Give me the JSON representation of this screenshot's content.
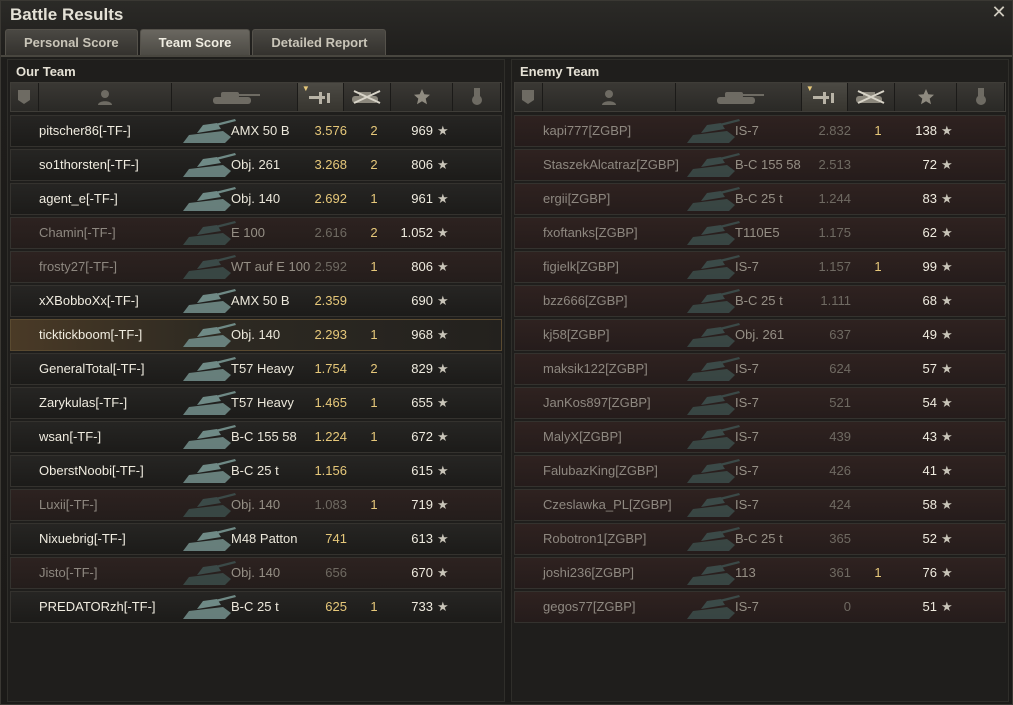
{
  "window": {
    "title": "Battle Results",
    "close_icon": "close-icon"
  },
  "tabs": [
    {
      "label": "Personal Score",
      "active": false
    },
    {
      "label": "Team Score",
      "active": true
    },
    {
      "label": "Detailed Report",
      "active": false
    }
  ],
  "columns": [
    "squad-icon",
    "player-icon",
    "tank-icon",
    "xp-icon",
    "kills-icon",
    "score-star-icon",
    "medal-icon"
  ],
  "our_team": {
    "title": "Our Team",
    "rows": [
      {
        "name": "pitscher86[-TF-]",
        "vehicle": "AMX 50 B",
        "xp": "3.576",
        "kills": "2",
        "score": "969",
        "state": "alive"
      },
      {
        "name": "so1thorsten[-TF-]",
        "vehicle": "Obj. 261",
        "xp": "3.268",
        "kills": "2",
        "score": "806",
        "state": "alive"
      },
      {
        "name": "agent_e[-TF-]",
        "vehicle": "Obj. 140",
        "xp": "2.692",
        "kills": "1",
        "score": "961",
        "state": "alive"
      },
      {
        "name": "Chamin[-TF-]",
        "vehicle": "E 100",
        "xp": "2.616",
        "kills": "2",
        "score": "1.052",
        "state": "dead"
      },
      {
        "name": "frosty27[-TF-]",
        "vehicle": "WT auf E 100",
        "xp": "2.592",
        "kills": "1",
        "score": "806",
        "state": "dead"
      },
      {
        "name": "xXBobboXx[-TF-]",
        "vehicle": "AMX 50 B",
        "xp": "2.359",
        "kills": "",
        "score": "690",
        "state": "alive"
      },
      {
        "name": "ticktickboom[-TF-]",
        "vehicle": "Obj. 140",
        "xp": "2.293",
        "kills": "1",
        "score": "968",
        "state": "self"
      },
      {
        "name": "GeneralTotal[-TF-]",
        "vehicle": "T57 Heavy",
        "xp": "1.754",
        "kills": "2",
        "score": "829",
        "state": "alive"
      },
      {
        "name": "Zarykulas[-TF-]",
        "vehicle": "T57 Heavy",
        "xp": "1.465",
        "kills": "1",
        "score": "655",
        "state": "alive"
      },
      {
        "name": "wsan[-TF-]",
        "vehicle": "B-C 155 58",
        "xp": "1.224",
        "kills": "1",
        "score": "672",
        "state": "alive"
      },
      {
        "name": "OberstNoobi[-TF-]",
        "vehicle": "B-C 25 t",
        "xp": "1.156",
        "kills": "",
        "score": "615",
        "state": "alive"
      },
      {
        "name": "Luxii[-TF-]",
        "vehicle": "Obj. 140",
        "xp": "1.083",
        "kills": "1",
        "score": "719",
        "state": "dead"
      },
      {
        "name": "Nixuebrig[-TF-]",
        "vehicle": "M48 Patton",
        "xp": "741",
        "kills": "",
        "score": "613",
        "state": "alive"
      },
      {
        "name": "Jisto[-TF-]",
        "vehicle": "Obj. 140",
        "xp": "656",
        "kills": "",
        "score": "670",
        "state": "dead"
      },
      {
        "name": "PREDATORzh[-TF-]",
        "vehicle": "B-C 25 t",
        "xp": "625",
        "kills": "1",
        "score": "733",
        "state": "alive"
      }
    ]
  },
  "enemy_team": {
    "title": "Enemy Team",
    "rows": [
      {
        "name": "kapi777[ZGBP]",
        "vehicle": "IS-7",
        "xp": "2.832",
        "kills": "1",
        "score": "138"
      },
      {
        "name": "StaszekAlcatraz[ZGBP]",
        "vehicle": "B-C 155 58",
        "xp": "2.513",
        "kills": "",
        "score": "72"
      },
      {
        "name": "ergii[ZGBP]",
        "vehicle": "B-C 25 t",
        "xp": "1.244",
        "kills": "",
        "score": "83"
      },
      {
        "name": "fxoftanks[ZGBP]",
        "vehicle": "T110E5",
        "xp": "1.175",
        "kills": "",
        "score": "62"
      },
      {
        "name": "figielk[ZGBP]",
        "vehicle": "IS-7",
        "xp": "1.157",
        "kills": "1",
        "score": "99"
      },
      {
        "name": "bzz666[ZGBP]",
        "vehicle": "B-C 25 t",
        "xp": "1.111",
        "kills": "",
        "score": "68"
      },
      {
        "name": "kj58[ZGBP]",
        "vehicle": "Obj. 261",
        "xp": "637",
        "kills": "",
        "score": "49"
      },
      {
        "name": "maksik122[ZGBP]",
        "vehicle": "IS-7",
        "xp": "624",
        "kills": "",
        "score": "57"
      },
      {
        "name": "JanKos897[ZGBP]",
        "vehicle": "IS-7",
        "xp": "521",
        "kills": "",
        "score": "54"
      },
      {
        "name": "MalyX[ZGBP]",
        "vehicle": "IS-7",
        "xp": "439",
        "kills": "",
        "score": "43"
      },
      {
        "name": "FalubazKing[ZGBP]",
        "vehicle": "IS-7",
        "xp": "426",
        "kills": "",
        "score": "41"
      },
      {
        "name": "Czeslawka_PL[ZGBP]",
        "vehicle": "IS-7",
        "xp": "424",
        "kills": "",
        "score": "58"
      },
      {
        "name": "Robotron1[ZGBP]",
        "vehicle": "B-C 25 t",
        "xp": "365",
        "kills": "",
        "score": "52"
      },
      {
        "name": "joshi236[ZGBP]",
        "vehicle": "113",
        "xp": "361",
        "kills": "1",
        "score": "76"
      },
      {
        "name": "gegos77[ZGBP]",
        "vehicle": "IS-7",
        "xp": "0",
        "kills": "",
        "score": "51"
      }
    ]
  }
}
